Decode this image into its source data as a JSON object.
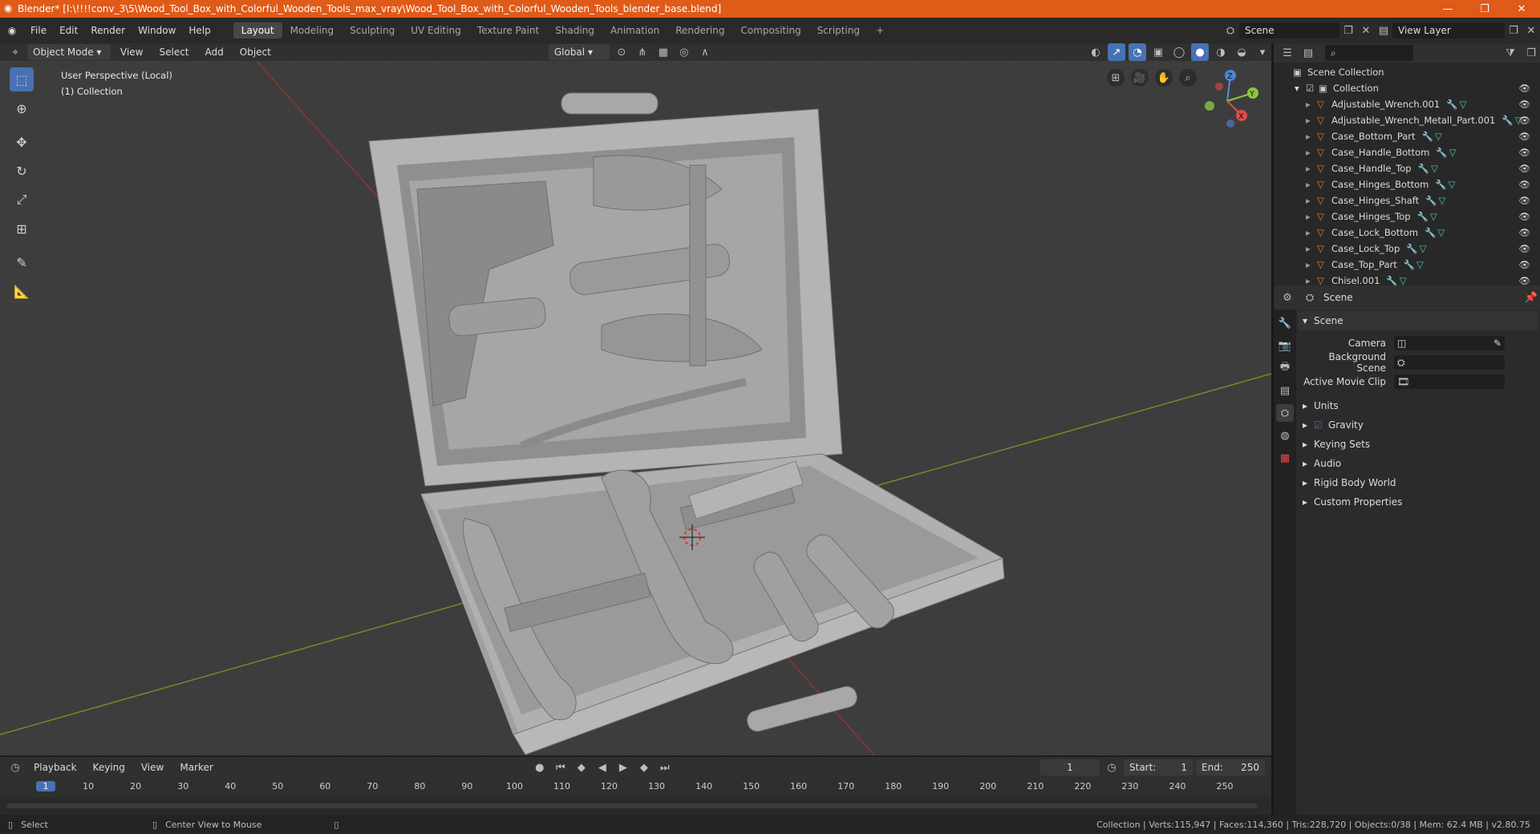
{
  "title": "Blender* [I:\\!!!!conv_3\\5\\Wood_Tool_Box_with_Colorful_Wooden_Tools_max_vray\\Wood_Tool_Box_with_Colorful_Wooden_Tools_blender_base.blend]",
  "menu": [
    "File",
    "Edit",
    "Render",
    "Window",
    "Help"
  ],
  "workspaces": [
    "Layout",
    "Modeling",
    "Sculpting",
    "UV Editing",
    "Texture Paint",
    "Shading",
    "Animation",
    "Rendering",
    "Compositing",
    "Scripting"
  ],
  "active_workspace": "Layout",
  "scene_name": "Scene",
  "view_layer": "View Layer",
  "viewport_header": {
    "mode": "Object Mode",
    "view": "View",
    "select": "Select",
    "add": "Add",
    "object": "Object",
    "orientation": "Global"
  },
  "viewport_info": {
    "line1": "User Perspective (Local)",
    "line2": "(1) Collection"
  },
  "outliner": {
    "scene_collection": "Scene Collection",
    "collection": "Collection",
    "items": [
      "Adjustable_Wrench.001",
      "Adjustable_Wrench_Metall_Part.001",
      "Case_Bottom_Part",
      "Case_Handle_Bottom",
      "Case_Handle_Top",
      "Case_Hinges_Bottom",
      "Case_Hinges_Shaft",
      "Case_Hinges_Top",
      "Case_Lock_Bottom",
      "Case_Lock_Top",
      "Case_Top_Part",
      "Chisel.001"
    ]
  },
  "properties": {
    "context": "Scene",
    "section": "Scene",
    "camera_label": "Camera",
    "background_label": "Background Scene",
    "movieclip_label": "Active Movie Clip",
    "panels": [
      "Units",
      "Gravity",
      "Keying Sets",
      "Audio",
      "Rigid Body World",
      "Custom Properties"
    ]
  },
  "timeline": {
    "playback": "Playback",
    "keying": "Keying",
    "view": "View",
    "marker": "Marker",
    "current": "1",
    "start_label": "Start:",
    "start": "1",
    "end_label": "End:",
    "end": "250",
    "ticks": [
      "1",
      "10",
      "20",
      "30",
      "40",
      "50",
      "60",
      "70",
      "80",
      "90",
      "100",
      "110",
      "120",
      "130",
      "140",
      "150",
      "160",
      "170",
      "180",
      "190",
      "200",
      "210",
      "220",
      "230",
      "240",
      "250"
    ]
  },
  "status": {
    "left": "Select",
    "middle": "Center View to Mouse",
    "right": "Collection | Verts:115,947 | Faces:114,360 | Tris:228,720 | Objects:0/38 | Mem: 62.4 MB | v2.80.75"
  },
  "colors": {
    "accent": "#4772b3",
    "title": "#e05a18",
    "mesh_icon": "#e8832a",
    "data_icon": "#3fd1a8"
  }
}
